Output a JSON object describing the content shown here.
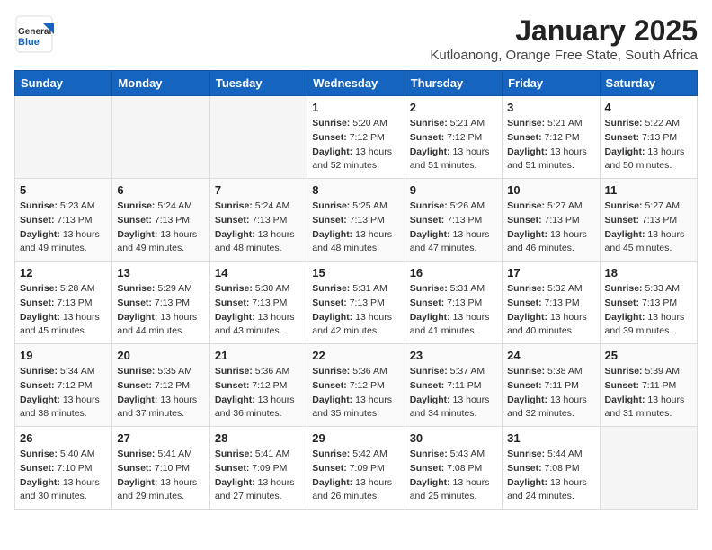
{
  "header": {
    "logo_general": "General",
    "logo_blue": "Blue",
    "month_year": "January 2025",
    "location": "Kutloanong, Orange Free State, South Africa"
  },
  "weekdays": [
    "Sunday",
    "Monday",
    "Tuesday",
    "Wednesday",
    "Thursday",
    "Friday",
    "Saturday"
  ],
  "weeks": [
    [
      {
        "day": "",
        "info": ""
      },
      {
        "day": "",
        "info": ""
      },
      {
        "day": "",
        "info": ""
      },
      {
        "day": "1",
        "info": "Sunrise: 5:20 AM\nSunset: 7:12 PM\nDaylight: 13 hours and 52 minutes."
      },
      {
        "day": "2",
        "info": "Sunrise: 5:21 AM\nSunset: 7:12 PM\nDaylight: 13 hours and 51 minutes."
      },
      {
        "day": "3",
        "info": "Sunrise: 5:21 AM\nSunset: 7:12 PM\nDaylight: 13 hours and 51 minutes."
      },
      {
        "day": "4",
        "info": "Sunrise: 5:22 AM\nSunset: 7:13 PM\nDaylight: 13 hours and 50 minutes."
      }
    ],
    [
      {
        "day": "5",
        "info": "Sunrise: 5:23 AM\nSunset: 7:13 PM\nDaylight: 13 hours and 49 minutes."
      },
      {
        "day": "6",
        "info": "Sunrise: 5:24 AM\nSunset: 7:13 PM\nDaylight: 13 hours and 49 minutes."
      },
      {
        "day": "7",
        "info": "Sunrise: 5:24 AM\nSunset: 7:13 PM\nDaylight: 13 hours and 48 minutes."
      },
      {
        "day": "8",
        "info": "Sunrise: 5:25 AM\nSunset: 7:13 PM\nDaylight: 13 hours and 48 minutes."
      },
      {
        "day": "9",
        "info": "Sunrise: 5:26 AM\nSunset: 7:13 PM\nDaylight: 13 hours and 47 minutes."
      },
      {
        "day": "10",
        "info": "Sunrise: 5:27 AM\nSunset: 7:13 PM\nDaylight: 13 hours and 46 minutes."
      },
      {
        "day": "11",
        "info": "Sunrise: 5:27 AM\nSunset: 7:13 PM\nDaylight: 13 hours and 45 minutes."
      }
    ],
    [
      {
        "day": "12",
        "info": "Sunrise: 5:28 AM\nSunset: 7:13 PM\nDaylight: 13 hours and 45 minutes."
      },
      {
        "day": "13",
        "info": "Sunrise: 5:29 AM\nSunset: 7:13 PM\nDaylight: 13 hours and 44 minutes."
      },
      {
        "day": "14",
        "info": "Sunrise: 5:30 AM\nSunset: 7:13 PM\nDaylight: 13 hours and 43 minutes."
      },
      {
        "day": "15",
        "info": "Sunrise: 5:31 AM\nSunset: 7:13 PM\nDaylight: 13 hours and 42 minutes."
      },
      {
        "day": "16",
        "info": "Sunrise: 5:31 AM\nSunset: 7:13 PM\nDaylight: 13 hours and 41 minutes."
      },
      {
        "day": "17",
        "info": "Sunrise: 5:32 AM\nSunset: 7:13 PM\nDaylight: 13 hours and 40 minutes."
      },
      {
        "day": "18",
        "info": "Sunrise: 5:33 AM\nSunset: 7:13 PM\nDaylight: 13 hours and 39 minutes."
      }
    ],
    [
      {
        "day": "19",
        "info": "Sunrise: 5:34 AM\nSunset: 7:12 PM\nDaylight: 13 hours and 38 minutes."
      },
      {
        "day": "20",
        "info": "Sunrise: 5:35 AM\nSunset: 7:12 PM\nDaylight: 13 hours and 37 minutes."
      },
      {
        "day": "21",
        "info": "Sunrise: 5:36 AM\nSunset: 7:12 PM\nDaylight: 13 hours and 36 minutes."
      },
      {
        "day": "22",
        "info": "Sunrise: 5:36 AM\nSunset: 7:12 PM\nDaylight: 13 hours and 35 minutes."
      },
      {
        "day": "23",
        "info": "Sunrise: 5:37 AM\nSunset: 7:11 PM\nDaylight: 13 hours and 34 minutes."
      },
      {
        "day": "24",
        "info": "Sunrise: 5:38 AM\nSunset: 7:11 PM\nDaylight: 13 hours and 32 minutes."
      },
      {
        "day": "25",
        "info": "Sunrise: 5:39 AM\nSunset: 7:11 PM\nDaylight: 13 hours and 31 minutes."
      }
    ],
    [
      {
        "day": "26",
        "info": "Sunrise: 5:40 AM\nSunset: 7:10 PM\nDaylight: 13 hours and 30 minutes."
      },
      {
        "day": "27",
        "info": "Sunrise: 5:41 AM\nSunset: 7:10 PM\nDaylight: 13 hours and 29 minutes."
      },
      {
        "day": "28",
        "info": "Sunrise: 5:41 AM\nSunset: 7:09 PM\nDaylight: 13 hours and 27 minutes."
      },
      {
        "day": "29",
        "info": "Sunrise: 5:42 AM\nSunset: 7:09 PM\nDaylight: 13 hours and 26 minutes."
      },
      {
        "day": "30",
        "info": "Sunrise: 5:43 AM\nSunset: 7:08 PM\nDaylight: 13 hours and 25 minutes."
      },
      {
        "day": "31",
        "info": "Sunrise: 5:44 AM\nSunset: 7:08 PM\nDaylight: 13 hours and 24 minutes."
      },
      {
        "day": "",
        "info": ""
      }
    ]
  ]
}
